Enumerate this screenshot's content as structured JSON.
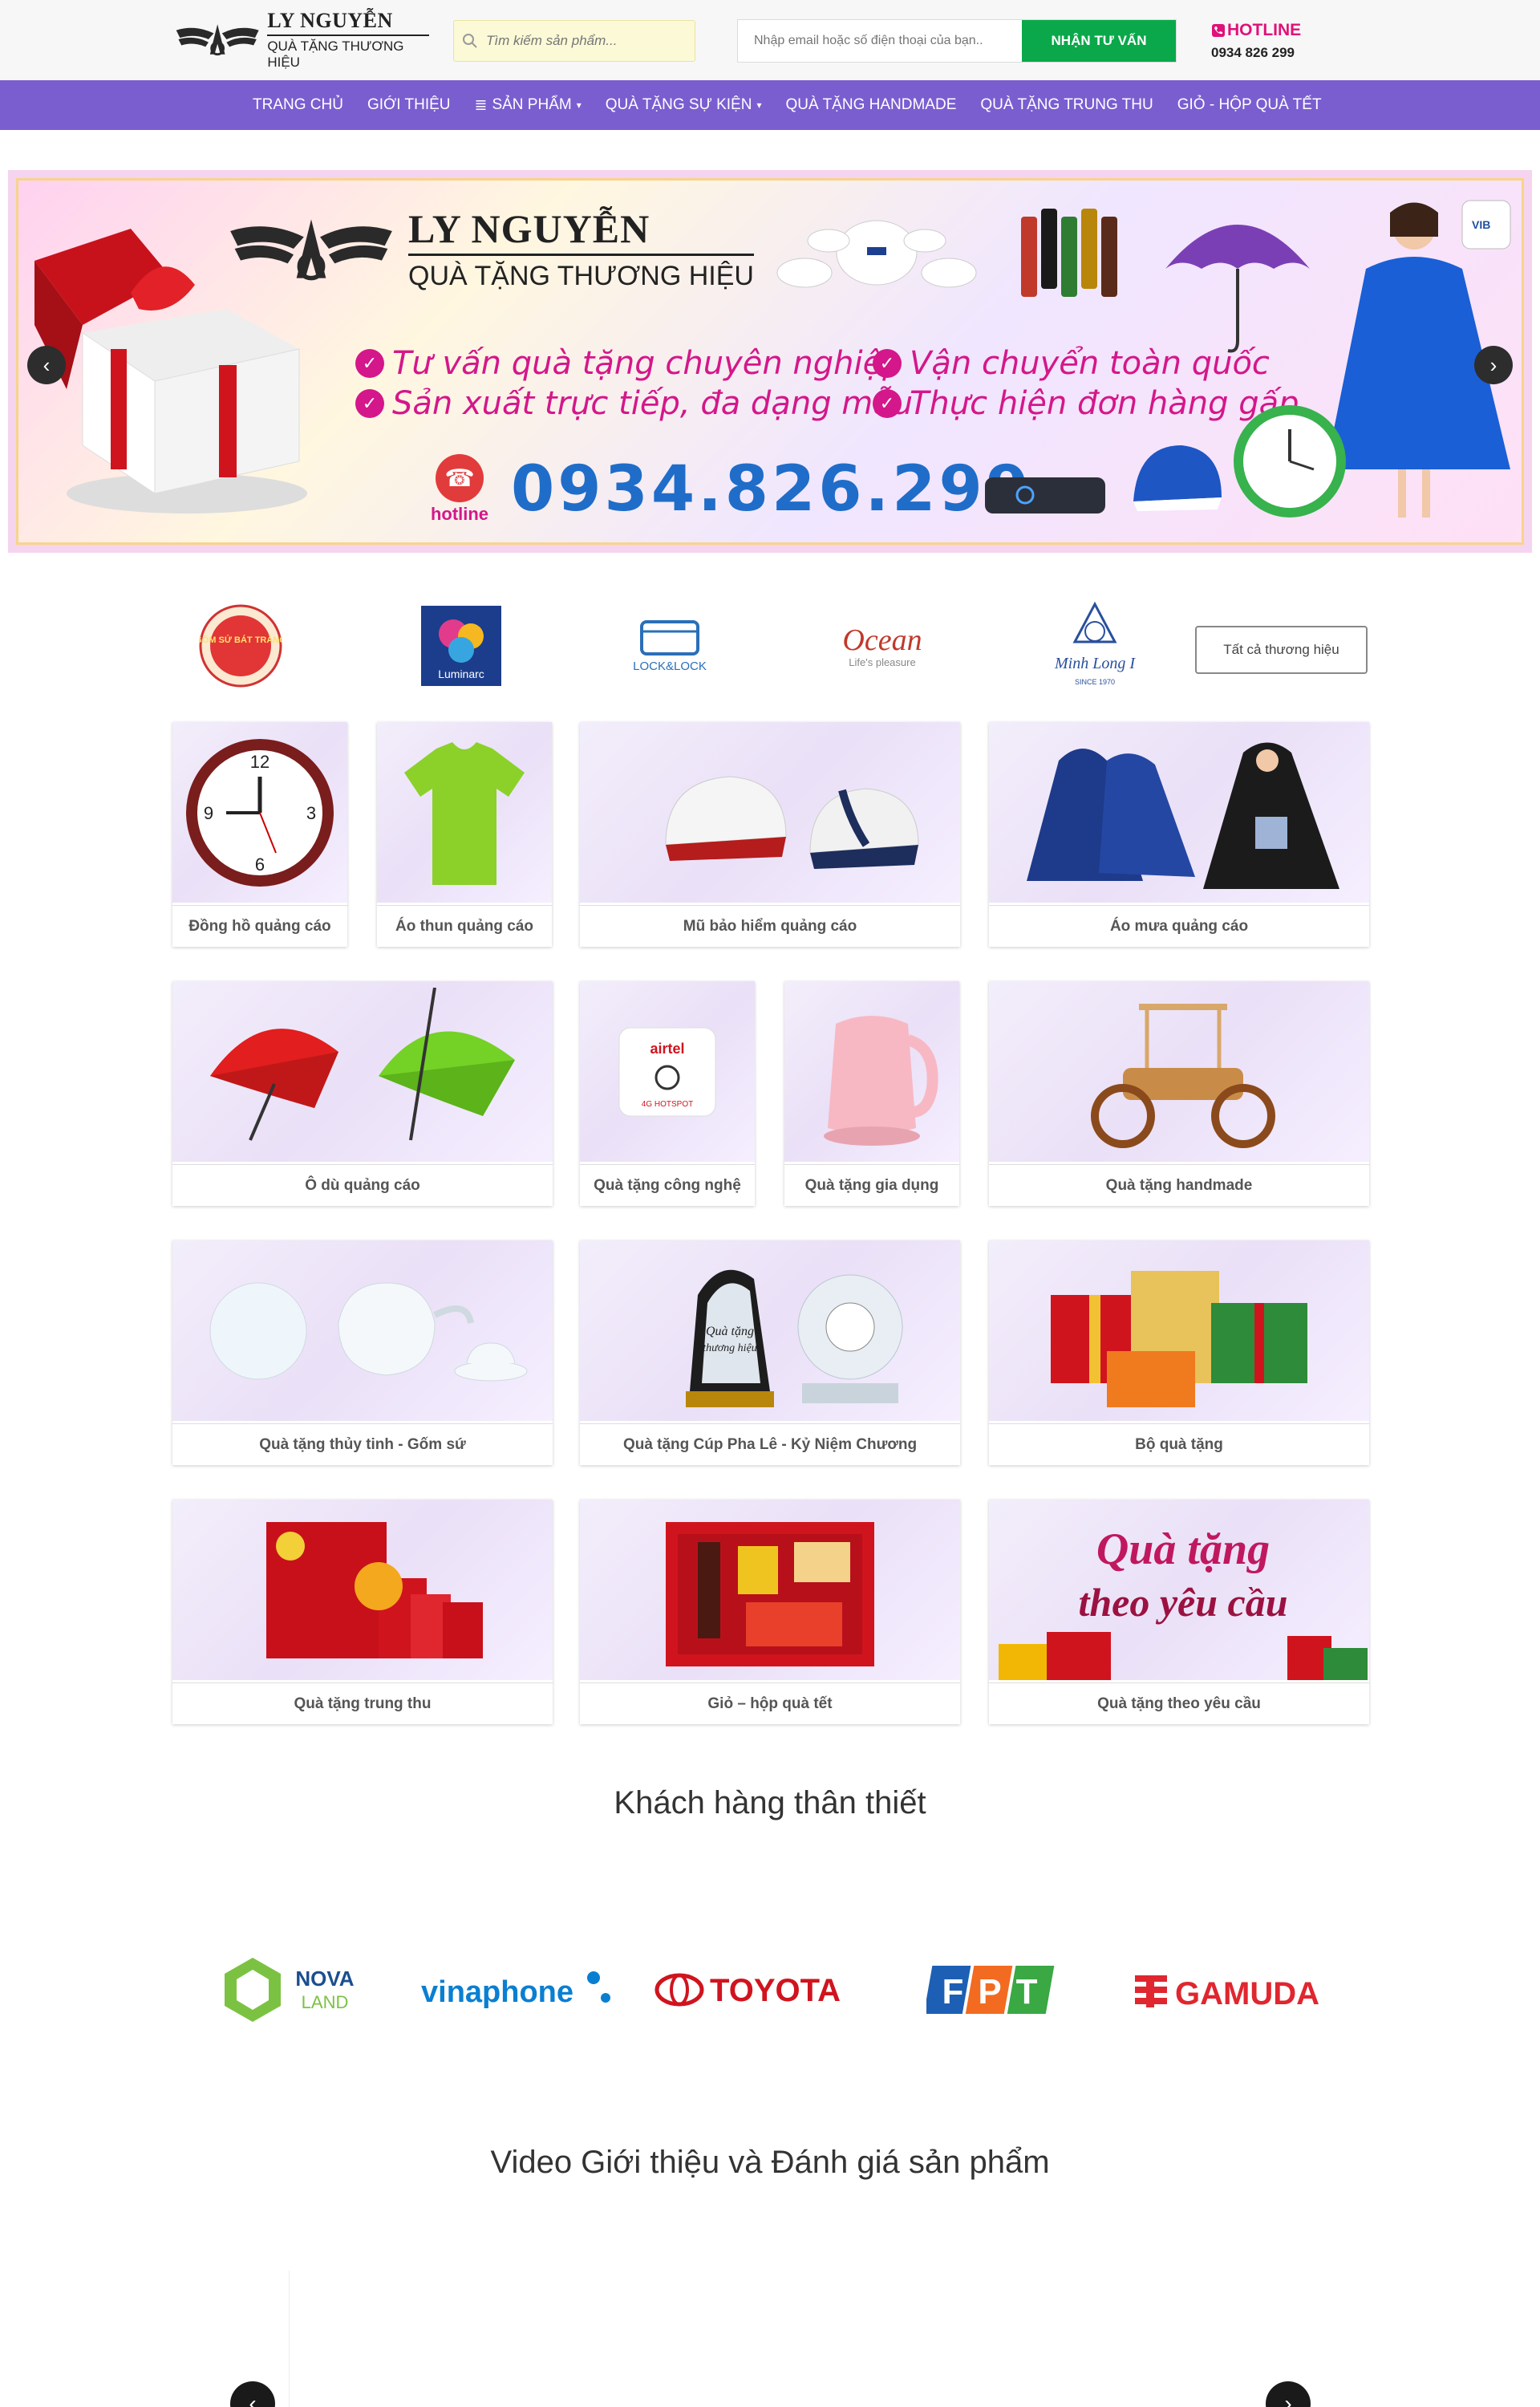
{
  "header": {
    "logo_title": "LY NGUYỄN",
    "logo_sub": "QUÀ TẶNG THƯƠNG HIỆU",
    "search_placeholder": "Tìm kiếm sản phẩm...",
    "consult_placeholder": "Nhập email hoặc số điện thoại của bạn..",
    "consult_button": "NHẬN TƯ VẤN",
    "hotline_label": "HOTLINE",
    "hotline_number": "0934 826 299"
  },
  "nav": {
    "items": [
      {
        "label": "TRANG CHỦ",
        "icon": ""
      },
      {
        "label": "GIỚI THIỆU",
        "icon": ""
      },
      {
        "label": "SẢN PHẨM",
        "icon": "menu-icon",
        "caret": "▾"
      },
      {
        "label": "QUÀ TẶNG SỰ KIỆN",
        "icon": "",
        "caret": "▾"
      },
      {
        "label": "QUÀ TẶNG HANDMADE",
        "icon": ""
      },
      {
        "label": "QUÀ TẶNG TRUNG THU",
        "icon": ""
      },
      {
        "label": "GIỎ - HỘP QUÀ TẾT",
        "icon": ""
      }
    ]
  },
  "banner": {
    "logo_title": "LY NGUYỄN",
    "logo_sub": "QUÀ TẶNG THƯƠNG HIỆU",
    "slogans": [
      "Tư vấn quà tặng chuyên nghiệp",
      "Vận chuyển toàn quốc",
      "Sản xuất trực tiếp, đa dạng mẫu",
      "Thực hiện đơn hàng gấp"
    ],
    "hotline_label": "hotline",
    "phone": "0934.826.299"
  },
  "brands": {
    "items": [
      "GỐM SỨ BÁT TRÀNG",
      "Luminarc",
      "LOCK&LOCK",
      "Ocean",
      "Life's pleasure",
      "Minh Long I",
      "SINCE 1970"
    ],
    "all_label": "Tất cả thương hiệu"
  },
  "categories": [
    "Đồng hồ quảng cáo",
    "Áo thun quảng cáo",
    "Mũ bảo hiểm quảng cáo",
    "Áo mưa quảng cáo",
    "Ô dù quảng cáo",
    "Quà tặng công nghệ",
    "Quà tặng gia dụng",
    "Quà tặng handmade",
    "Quà tặng thủy tinh - Gốm sứ",
    "Quà tặng Cúp Pha Lê - Kỷ Niệm Chương",
    "Bộ quà tặng",
    "Quà tặng trung thu",
    "Giỏ – hộp quà tết",
    "Quà tặng theo yêu cầu"
  ],
  "thumb_text": {
    "custom_line1": "Quà tặng",
    "custom_line2": "theo yêu cầu",
    "cup_line1": "Quà tặng",
    "cup_line2": "thương hiệu",
    "airtel": "airtel",
    "hotspot": "4G HOTSPOT"
  },
  "sections": {
    "customers_title": "Khách hàng thân thiết",
    "video_title": "Video Giới thiệu và Đánh giá sản phẩm"
  },
  "partners": [
    "NOVA",
    "LAND",
    "vinaphone",
    "TOYOTA",
    "FPT",
    "GAMUDA"
  ],
  "colors": {
    "nav_bg": "#7a5ed0",
    "consult_button": "#0aa84a",
    "hotline": "#e0117a",
    "banner_phone": "#1f6dc9"
  }
}
